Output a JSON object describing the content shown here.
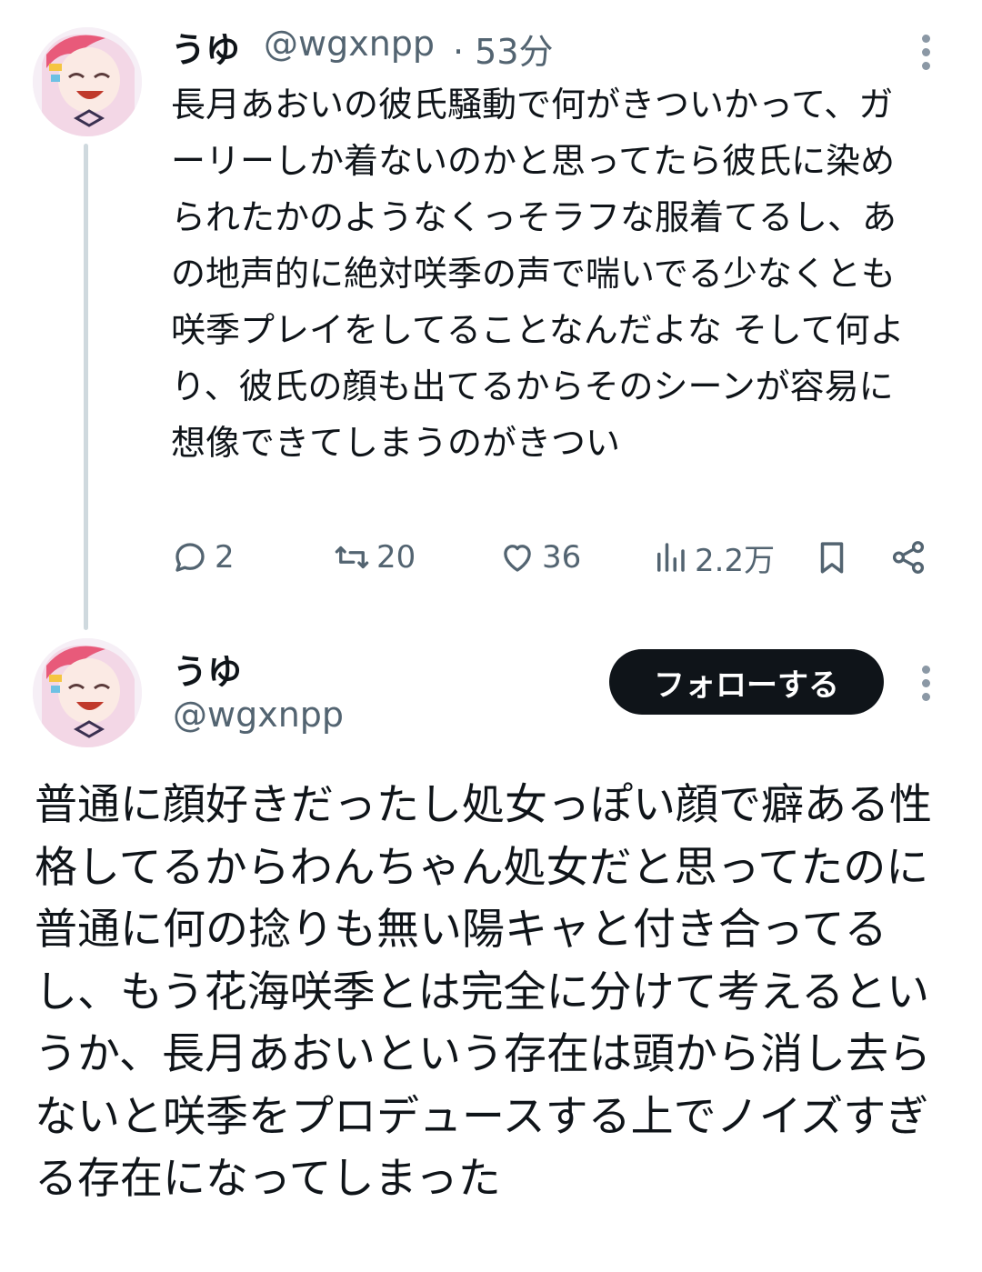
{
  "tweet1": {
    "display_name": "うゆ",
    "handle": "@wgxnpp",
    "time": "· 53分",
    "text": "長月あおいの彼氏騒動で何がきついかって、ガーリーしか着ないのかと思ってたら彼氏に染められたかのようなくっそラフな服着てるし、あの地声的に絶対咲季の声で喘いでる少なくとも咲季プレイをしてることなんだよな そして何より、彼氏の顔も出てるからそのシーンが容易に想像できてしまうのがきつい",
    "actions": {
      "replies": "2",
      "retweets": "20",
      "likes": "36",
      "views": "2.2万"
    }
  },
  "tweet2": {
    "display_name": "うゆ",
    "handle": "@wgxnpp",
    "follow_label": "フォローする",
    "text": "普通に顔好きだったし処女っぽい顔で癖ある性格してるからわんちゃん処女だと思ってたのに普通に何の捻りも無い陽キャと付き合ってるし、もう花海咲季とは完全に分けて考えるというか、長月あおいという存在は頭から消し去らないと咲季をプロデュースする上でノイズすぎる存在になってしまった"
  },
  "icons": [
    "avatar",
    "more-options-icon",
    "reply-icon",
    "retweet-icon",
    "like-icon",
    "views-icon",
    "bookmark-icon",
    "share-icon"
  ],
  "colors": {
    "text": "#0f1419",
    "secondary": "#536471",
    "thread_line": "#cfd9de",
    "follow_button": "#0f1419"
  }
}
